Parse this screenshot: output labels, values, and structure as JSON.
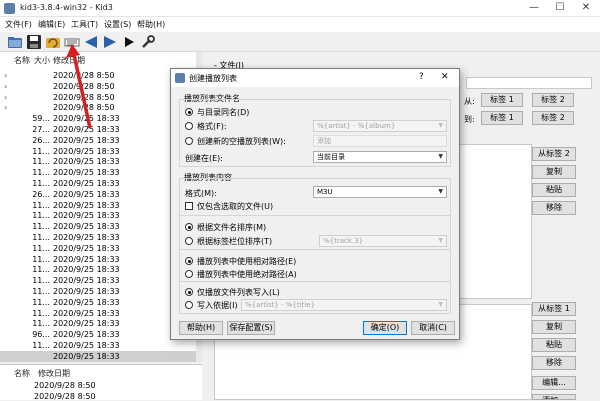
{
  "window": {
    "title": "kid3-3.8.4-win32 - Kid3",
    "minimize": "—",
    "maximize": "☐",
    "close": "✕"
  },
  "menu": [
    "文件(F)",
    "编辑(E)",
    "工具(T)",
    "设置(S)",
    "帮助(H)"
  ],
  "toolbar": {
    "icons": [
      "open-folder-icon",
      "save-icon",
      "revert-icon",
      "create-playlist-icon",
      "previous-icon",
      "next-icon",
      "play-icon",
      "settings-icon"
    ]
  },
  "file_list": {
    "headers": {
      "name": "名称",
      "size": "大小",
      "modified": "修改日期"
    },
    "rows": [
      {
        "arrow": "›",
        "size": "",
        "date": "2020/9/28 8:50"
      },
      {
        "arrow": "›",
        "size": "",
        "date": "2020/9/28 8:50"
      },
      {
        "arrow": "›",
        "size": "",
        "date": "2020/9/28 8:50"
      },
      {
        "arrow": "›",
        "size": "",
        "date": "2020/9/28 8:50"
      },
      {
        "arrow": "",
        "size": "59...",
        "date": "2020/9/25 18:33"
      },
      {
        "arrow": "",
        "size": "27...",
        "date": "2020/9/25 18:33"
      },
      {
        "arrow": "",
        "size": "26...",
        "date": "2020/9/25 18:33"
      },
      {
        "arrow": "",
        "size": "11...",
        "date": "2020/9/25 18:33"
      },
      {
        "arrow": "",
        "size": "11...",
        "date": "2020/9/25 18:33"
      },
      {
        "arrow": "",
        "size": "11...",
        "date": "2020/9/25 18:33"
      },
      {
        "arrow": "",
        "size": "11...",
        "date": "2020/9/25 18:33"
      },
      {
        "arrow": "",
        "size": "26...",
        "date": "2020/9/25 18:33"
      },
      {
        "arrow": "",
        "size": "11...",
        "date": "2020/9/25 18:33"
      },
      {
        "arrow": "",
        "size": "11...",
        "date": "2020/9/25 18:33"
      },
      {
        "arrow": "",
        "size": "11...",
        "date": "2020/9/25 18:33"
      },
      {
        "arrow": "",
        "size": "11...",
        "date": "2020/9/25 18:33"
      },
      {
        "arrow": "",
        "size": "11...",
        "date": "2020/9/25 18:33"
      },
      {
        "arrow": "",
        "size": "11...",
        "date": "2020/9/25 18:33"
      },
      {
        "arrow": "",
        "size": "11...",
        "date": "2020/9/25 18:33"
      },
      {
        "arrow": "",
        "size": "11...",
        "date": "2020/9/25 18:33"
      },
      {
        "arrow": "",
        "size": "11...",
        "date": "2020/9/25 18:33"
      },
      {
        "arrow": "",
        "size": "11...",
        "date": "2020/9/25 18:33"
      },
      {
        "arrow": "",
        "size": "11...",
        "date": "2020/9/25 18:33"
      },
      {
        "arrow": "",
        "size": "11...",
        "date": "2020/9/25 18:33"
      },
      {
        "arrow": "",
        "size": "96...",
        "date": "2020/9/25 18:33"
      },
      {
        "arrow": "",
        "size": "11...",
        "date": "2020/9/25 18:33"
      },
      {
        "arrow": "",
        "size": "",
        "date": "2020/9/25 18:33"
      }
    ],
    "selected_index": 26
  },
  "dir_list": {
    "headers": {
      "name": "名称",
      "modified": "修改日期"
    },
    "rows": [
      "2020/9/28 8:50",
      "2020/9/28 8:50"
    ]
  },
  "right": {
    "file_label": "- 文件(I)",
    "from_label": "从:",
    "to_label": "到:",
    "from_tag1": "标签 1",
    "from_tag2": "标签 2",
    "to_tag1": "标签 1",
    "to_tag2": "标签 2",
    "tag2_section": {
      "from_tag": "从标签 2",
      "copy": "复制",
      "paste": "粘贴",
      "remove": "移除"
    },
    "tag1_section": {
      "from_tag": "从标签 1",
      "copy": "复制",
      "paste": "粘贴",
      "remove": "移除",
      "edit": "编辑...",
      "add": "添加..."
    }
  },
  "dialog": {
    "title": "创建播放列表",
    "help_glyph": "?",
    "close_glyph": "✕",
    "filename_group": "播放列表文件名",
    "same_as_dir": "与目录同名(D)",
    "format_label": "格式(F):",
    "format_value": "%{artist} - %{album}",
    "create_empty": "创建新的空播放列表(W):",
    "create_empty_value": "添加",
    "create_in_label": "创建在(E):",
    "create_in_value": "当前目录",
    "content_group": "播放列表内容",
    "content_format_label": "格式(M):",
    "content_format_value": "M3U",
    "only_selected": "仅包含选取的文件(U)",
    "sort_filename": "根据文件名排序(M)",
    "sort_tag": "根据标签栏位排序(T)",
    "sort_tag_value": "%{track.3}",
    "relative_path": "播放列表中使用相对路径(E)",
    "absolute_path": "播放列表中使用绝对路径(A)",
    "write_only_names": "仅播放文件列表写入(L)",
    "write_info": "写入依据(I)",
    "write_info_value": "%{artist} - %{title}",
    "help_button": "帮助(H)",
    "save_settings_button": "保存配置(S)",
    "ok_button": "确定(O)",
    "cancel_button": "取消(C)"
  },
  "colors": {
    "annotation_arrow": "#d42020",
    "default_button_border": "#0078d7",
    "selection": "#cfcfcf"
  }
}
